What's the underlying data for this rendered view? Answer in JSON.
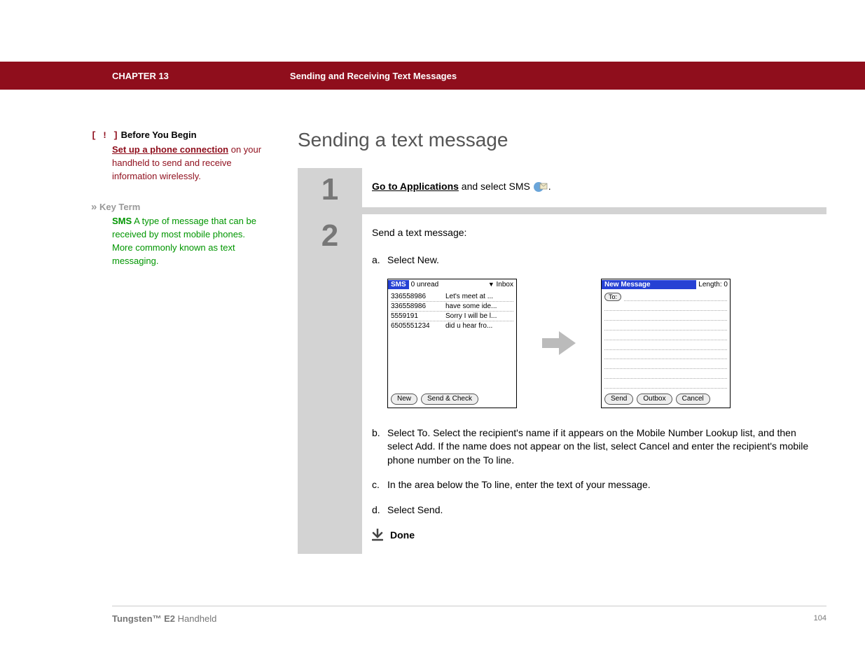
{
  "header": {
    "chapter": "CHAPTER 13",
    "title": "Sending and Receiving Text Messages"
  },
  "page_heading": "Sending a text message",
  "sidebar": {
    "byb": {
      "marker": "[ ! ]",
      "heading": "Before You Begin",
      "link": "Set up a phone connection",
      "rest": " on your handheld to send and receive information wirelessly."
    },
    "kt": {
      "marker": "»",
      "heading": "Key Term",
      "term": "SMS",
      "definition": "   A type of message that can be received by most mobile phones. More commonly known as text messaging."
    }
  },
  "steps": [
    {
      "num": "1",
      "link": "Go to Applications",
      "rest": " and select SMS ",
      "dot": "."
    },
    {
      "num": "2",
      "intro": "Send a text message:",
      "a": "Select New.",
      "b": "Select To. Select the recipient's name if it appears on the Mobile Number Lookup list, and then select Add. If the name does not appear on the list, select Cancel and enter the recipient's mobile phone number on the To line.",
      "c": "In the area below the To line, enter the text of your message.",
      "d": "Select Send.",
      "done": "Done"
    }
  ],
  "inbox_screen": {
    "app": "SMS",
    "unread": "0 unread",
    "folder": "Inbox",
    "rows": [
      {
        "num": "336558986",
        "snip": "Let's meet at ..."
      },
      {
        "num": "336558986",
        "snip": "have some ide..."
      },
      {
        "num": "5559191",
        "snip": "Sorry I will be l..."
      },
      {
        "num": "6505551234",
        "snip": "did u hear fro..."
      }
    ],
    "buttons": [
      "New",
      "Send & Check"
    ]
  },
  "new_msg_screen": {
    "title": "New Message",
    "length": "Length: 0",
    "to": "To:",
    "buttons": [
      "Send",
      "Outbox",
      "Cancel"
    ]
  },
  "footer": {
    "product_bold": "Tungsten™ E2",
    "product_rest": " Handheld",
    "page": "104"
  }
}
